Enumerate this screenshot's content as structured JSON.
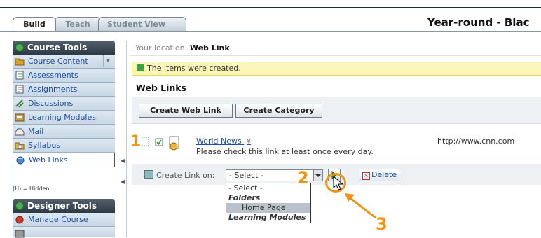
{
  "tabs": {
    "build": "Build",
    "teach": "Teach",
    "student_view": "Student View"
  },
  "course_title": "Year-round - Blac",
  "course_tools": {
    "heading": "Course Tools",
    "items": [
      {
        "label": "Course Content"
      },
      {
        "label": "Assessments"
      },
      {
        "label": "Assignments"
      },
      {
        "label": "Discussions"
      },
      {
        "label": "Learning Modules"
      },
      {
        "label": "Mail"
      },
      {
        "label": "Syllabus"
      },
      {
        "label": "Web Links"
      }
    ],
    "hidden_note": "(H) = Hidden",
    "collapse_glyph": "¥"
  },
  "designer_tools": {
    "heading": "Designer Tools",
    "items": [
      {
        "label": "Manage Course"
      }
    ]
  },
  "location": {
    "label": "Your location:",
    "value": "Web Link"
  },
  "success_message": "The items were created.",
  "section_title": "Web Links",
  "buttons": {
    "create_web_link": "Create Web Link",
    "create_category": "Create Category"
  },
  "link_item": {
    "title": "World News",
    "flag": "¥",
    "description": "Please check this link at least once every day.",
    "url": "http://www.cnn.com"
  },
  "create_link": {
    "label": "Create Link on:",
    "selected": "- Select -",
    "delete_label": "Delete",
    "options": [
      {
        "label": "- Select -",
        "type": "option"
      },
      {
        "label": "Folders",
        "type": "group"
      },
      {
        "label": "Home Page",
        "type": "highlight"
      },
      {
        "label": "Learning Modules",
        "type": "group"
      }
    ]
  },
  "callouts": {
    "one": "1",
    "two": "2",
    "three": "3"
  },
  "colors": {
    "accent_orange": "#f29211",
    "link_blue": "#1f4fa0",
    "menu_dark": "#2e3945",
    "success_bg": "#fbf6b8"
  }
}
